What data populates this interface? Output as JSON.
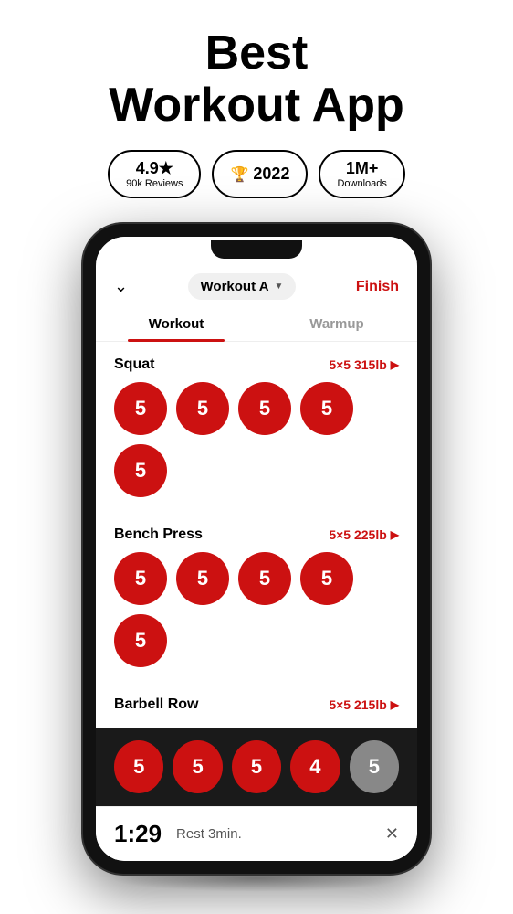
{
  "header": {
    "line1": "Best",
    "line2": "Workout App"
  },
  "badges": [
    {
      "id": "rating",
      "main": "4.9★",
      "sub": "90k Reviews"
    },
    {
      "id": "award",
      "icon": "🏆",
      "main": "2022",
      "sub": null
    },
    {
      "id": "downloads",
      "main": "1M+",
      "sub": "Downloads"
    }
  ],
  "app": {
    "workout_name": "Workout A",
    "finish_label": "Finish",
    "tabs": [
      {
        "id": "workout",
        "label": "Workout",
        "active": true
      },
      {
        "id": "warmup",
        "label": "Warmup",
        "active": false
      }
    ],
    "exercises": [
      {
        "name": "Squat",
        "meta": "5×5 315lb",
        "sets": [
          5,
          5,
          5,
          5,
          5
        ],
        "active_count": 5
      },
      {
        "name": "Bench Press",
        "meta": "5×5 225lb",
        "sets": [
          5,
          5,
          5,
          5,
          5
        ],
        "active_count": 5
      },
      {
        "name": "Barbell Row",
        "meta": "5×5 215lb",
        "sets": [
          5,
          5,
          5,
          4,
          5
        ],
        "active_count": 4
      }
    ],
    "bottom_sets": [
      5,
      5,
      5,
      4,
      5
    ],
    "bottom_inactive_index": 4,
    "rest_timer": {
      "time": "1:29",
      "label": "Rest 3min."
    }
  }
}
